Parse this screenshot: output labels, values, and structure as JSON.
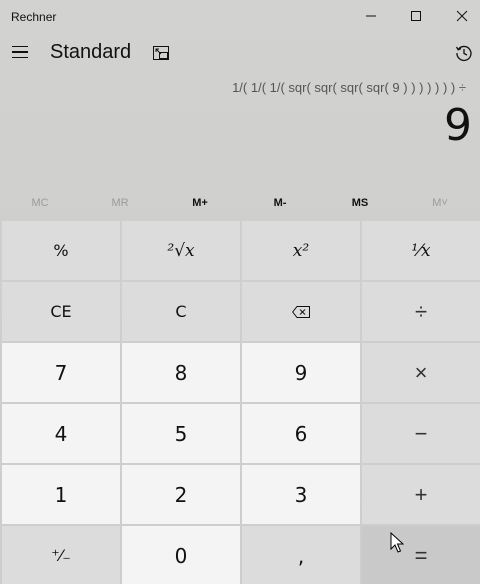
{
  "window": {
    "title": "Rechner"
  },
  "header": {
    "mode": "Standard"
  },
  "display": {
    "expression": "1/( 1/( 1/( sqr( sqr( sqr( sqr( 9 ) ) ) ) ) ) ) ÷",
    "result": "9"
  },
  "memory": [
    {
      "label": "MC",
      "enabled": false
    },
    {
      "label": "MR",
      "enabled": false
    },
    {
      "label": "M+",
      "enabled": true
    },
    {
      "label": "M-",
      "enabled": true
    },
    {
      "label": "MS",
      "enabled": true
    },
    {
      "label": "M˅",
      "enabled": false
    }
  ],
  "keys": {
    "percent": "%",
    "sqrt": "²√x",
    "square": "x²",
    "reciprocal": "¹⁄x",
    "clear_entry": "CE",
    "clear": "C",
    "divide": "÷",
    "seven": "7",
    "eight": "8",
    "nine": "9",
    "multiply": "×",
    "four": "4",
    "five": "5",
    "six": "6",
    "minus": "−",
    "one": "1",
    "two": "2",
    "three": "3",
    "plus": "+",
    "negate": "⁺⁄₋",
    "zero": "0",
    "decimal": ",",
    "equals": "="
  },
  "icons": {
    "minimize": "minimize-icon",
    "maximize": "maximize-icon",
    "close": "close-icon",
    "menu": "hamburger-icon",
    "keep_on_top": "keep-on-top-icon",
    "history": "history-icon",
    "backspace": "backspace-icon"
  }
}
